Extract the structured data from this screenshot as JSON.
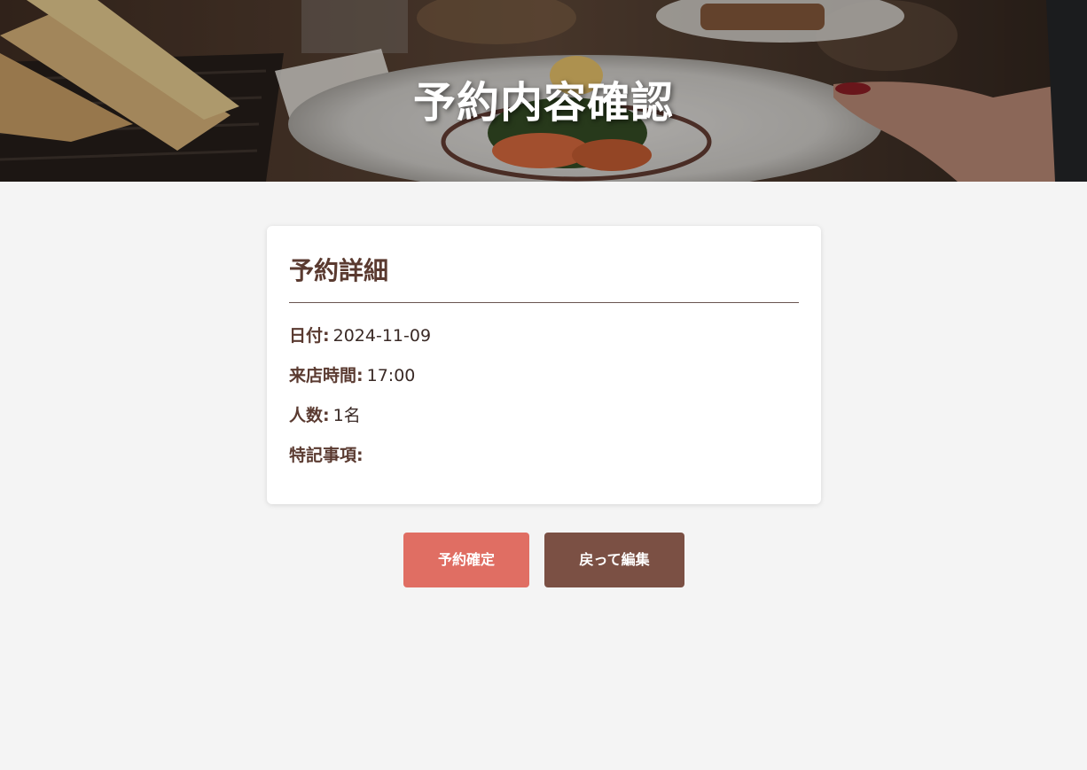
{
  "header": {
    "title": "予約内容確認"
  },
  "details": {
    "heading": "予約詳細",
    "rows": [
      {
        "label": "日付:",
        "value": "2024-11-09"
      },
      {
        "label": "来店時間:",
        "value": "17:00"
      },
      {
        "label": "人数:",
        "value": "1名"
      },
      {
        "label": "特記事項:",
        "value": ""
      }
    ]
  },
  "actions": {
    "confirm_label": "予約確定",
    "back_label": "戻って編集"
  },
  "colors": {
    "page_bg": "#f4f4f4",
    "heading": "#5a3a30",
    "confirm_button": "#e06e63",
    "back_button": "#7b5044"
  }
}
